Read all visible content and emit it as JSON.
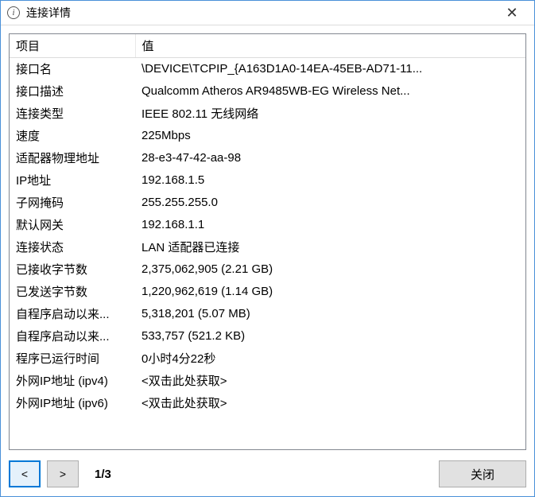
{
  "window": {
    "title": "连接详情"
  },
  "headers": {
    "key": "项目",
    "value": "值"
  },
  "rows": [
    {
      "k": "接口名",
      "v": "\\DEVICE\\TCPIP_{A163D1A0-14EA-45EB-AD71-11..."
    },
    {
      "k": "接口描述",
      "v": "Qualcomm Atheros AR9485WB-EG Wireless Net..."
    },
    {
      "k": "连接类型",
      "v": "IEEE 802.11 无线网络"
    },
    {
      "k": "速度",
      "v": "225Mbps"
    },
    {
      "k": "适配器物理地址",
      "v": "28-e3-47-42-aa-98"
    },
    {
      "k": "IP地址",
      "v": "192.168.1.5"
    },
    {
      "k": "子网掩码",
      "v": "255.255.255.0"
    },
    {
      "k": "默认网关",
      "v": "192.168.1.1"
    },
    {
      "k": "连接状态",
      "v": "LAN 适配器已连接"
    },
    {
      "k": "已接收字节数",
      "v": "2,375,062,905 (2.21 GB)"
    },
    {
      "k": "已发送字节数",
      "v": "1,220,962,619 (1.14 GB)"
    },
    {
      "k": "自程序启动以来...",
      "v": "5,318,201 (5.07 MB)"
    },
    {
      "k": "自程序启动以来...",
      "v": "533,757 (521.2 KB)"
    },
    {
      "k": "程序已运行时间",
      "v": "0小时4分22秒"
    },
    {
      "k": "外网IP地址 (ipv4)",
      "v": "<双击此处获取>"
    },
    {
      "k": "外网IP地址 (ipv6)",
      "v": "<双击此处获取>"
    }
  ],
  "nav": {
    "prev": "<",
    "next": ">",
    "page": "1/3",
    "close": "关闭"
  }
}
